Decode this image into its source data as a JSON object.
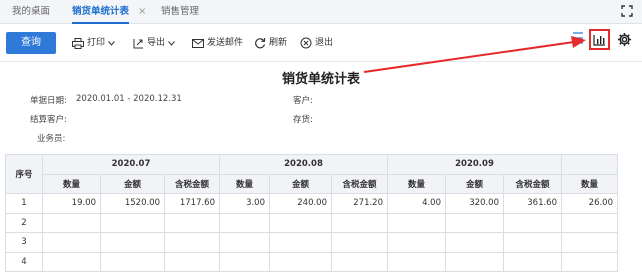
{
  "tabs": [
    {
      "label": "我的桌面"
    },
    {
      "label": "销货单统计表"
    },
    {
      "label": "销售管理"
    }
  ],
  "tab_close": "×",
  "toolbar": {
    "query": "查询",
    "print": "打印",
    "export": "导出",
    "send_email": "发送邮件",
    "refresh": "刷新",
    "exit": "退出"
  },
  "report": {
    "title": "销货单统计表",
    "filters": {
      "date_label": "单据日期:",
      "date_value": "2020.01.01 - 2020.12.31",
      "customer_label": "客户:",
      "customer_value": "",
      "settle_label": "结算客户:",
      "settle_value": "",
      "stock_label": "存货:",
      "stock_value": "",
      "salesman_label": "业务员:",
      "salesman_value": ""
    }
  },
  "table": {
    "index_header": "序号",
    "periods": [
      "2020.07",
      "2020.08",
      "2020.09"
    ],
    "subheaders": [
      "数量",
      "金额",
      "含税金额",
      "数量",
      "金额",
      "含税金额",
      "数量",
      "金额",
      "含税金额",
      "数量"
    ],
    "rows": [
      {
        "index": "1",
        "cells": [
          "19.00",
          "1520.00",
          "1717.60",
          "3.00",
          "240.00",
          "271.20",
          "4.00",
          "320.00",
          "361.60",
          "26.00"
        ]
      },
      {
        "index": "2",
        "cells": [
          "",
          "",
          "",
          "",
          "",
          "",
          "",
          "",
          "",
          ""
        ]
      },
      {
        "index": "3",
        "cells": [
          "",
          "",
          "",
          "",
          "",
          "",
          "",
          "",
          "",
          ""
        ]
      },
      {
        "index": "4",
        "cells": [
          "",
          "",
          "",
          "",
          "",
          "",
          "",
          "",
          "",
          ""
        ]
      }
    ]
  },
  "colors": {
    "accent": "#1e6fd0",
    "button": "#2f7ad8",
    "highlight": "#e52b2b"
  }
}
